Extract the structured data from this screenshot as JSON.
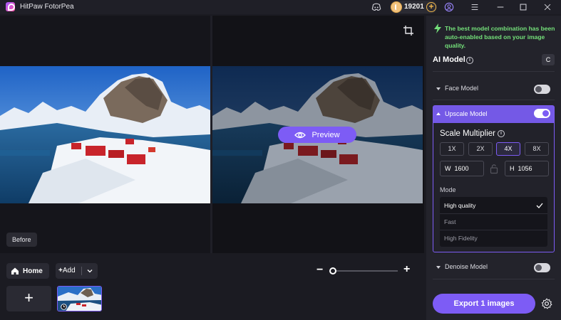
{
  "app": {
    "title": "HitPaw FotorPea",
    "coins": "19201"
  },
  "canvas": {
    "preview_label": "Preview",
    "before_label": "Before"
  },
  "bottom": {
    "home_label": "Home",
    "add_label": "Add",
    "add_thumb_label": "+"
  },
  "sidebar": {
    "notice": "The best model combination has been auto-enabled based on your image quality.",
    "ai_model_title": "AI Model",
    "refresh_label": "C",
    "face_model": {
      "label": "Face Model",
      "enabled": false
    },
    "upscale_model": {
      "label": "Upscale Model",
      "enabled": true
    },
    "scale_multiplier_title": "Scale Multiplier",
    "multipliers": [
      "1X",
      "2X",
      "4X",
      "8X"
    ],
    "selected_multiplier": "4X",
    "width_prefix": "W",
    "width_value": "1600",
    "height_prefix": "H",
    "height_value": "1056",
    "mode_title": "Mode",
    "modes": [
      "High quality",
      "Fast",
      "High Fidelity"
    ],
    "selected_mode": "High quality",
    "denoise_model": {
      "label": "Denoise Model",
      "enabled": false
    },
    "export_label": "Export 1 images"
  },
  "colors": {
    "accent": "#7d5cf5",
    "notice_green": "#74e07a",
    "coin_gold": "#f1c27d"
  }
}
